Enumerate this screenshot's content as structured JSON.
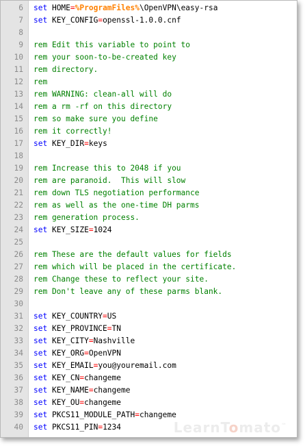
{
  "editor": {
    "colors": {
      "keyword": "#0000ff",
      "operator": "#ff0000",
      "variable": "#ff8000",
      "comment": "#008000",
      "plain": "#000000",
      "line_number": "#8a8a8a",
      "gutter": "#e4e4e4"
    },
    "lines": [
      {
        "n": "6",
        "tokens": [
          {
            "t": "set",
            "c": "kw"
          },
          {
            "t": " HOME",
            "c": "pl"
          },
          {
            "t": "=",
            "c": "op"
          },
          {
            "t": "%ProgramFiles%",
            "c": "var"
          },
          {
            "t": "\\OpenVPN\\easy-rsa",
            "c": "pl"
          }
        ]
      },
      {
        "n": "7",
        "tokens": [
          {
            "t": "set",
            "c": "kw"
          },
          {
            "t": " KEY_CONFIG",
            "c": "pl"
          },
          {
            "t": "=",
            "c": "op"
          },
          {
            "t": "openssl-1.0.0.cnf",
            "c": "pl"
          }
        ]
      },
      {
        "n": "8",
        "tokens": []
      },
      {
        "n": "9",
        "tokens": [
          {
            "t": "rem Edit this variable to point to",
            "c": "cm"
          }
        ]
      },
      {
        "n": "10",
        "tokens": [
          {
            "t": "rem your soon-to-be-created key",
            "c": "cm"
          }
        ]
      },
      {
        "n": "11",
        "tokens": [
          {
            "t": "rem directory.",
            "c": "cm"
          }
        ]
      },
      {
        "n": "12",
        "tokens": [
          {
            "t": "rem",
            "c": "cm"
          }
        ]
      },
      {
        "n": "13",
        "tokens": [
          {
            "t": "rem WARNING: clean-all will do",
            "c": "cm"
          }
        ]
      },
      {
        "n": "14",
        "tokens": [
          {
            "t": "rem a rm -rf on this directory",
            "c": "cm"
          }
        ]
      },
      {
        "n": "15",
        "tokens": [
          {
            "t": "rem so make sure you define",
            "c": "cm"
          }
        ]
      },
      {
        "n": "16",
        "tokens": [
          {
            "t": "rem it correctly!",
            "c": "cm"
          }
        ]
      },
      {
        "n": "17",
        "tokens": [
          {
            "t": "set",
            "c": "kw"
          },
          {
            "t": " KEY_DIR",
            "c": "pl"
          },
          {
            "t": "=",
            "c": "op"
          },
          {
            "t": "keys",
            "c": "pl"
          }
        ]
      },
      {
        "n": "18",
        "tokens": []
      },
      {
        "n": "19",
        "tokens": [
          {
            "t": "rem Increase this to 2048 if you",
            "c": "cm"
          }
        ]
      },
      {
        "n": "20",
        "tokens": [
          {
            "t": "rem are paranoid.  This will slow",
            "c": "cm"
          }
        ]
      },
      {
        "n": "21",
        "tokens": [
          {
            "t": "rem down TLS negotiation performance",
            "c": "cm"
          }
        ]
      },
      {
        "n": "22",
        "tokens": [
          {
            "t": "rem as well as the one-time DH parms",
            "c": "cm"
          }
        ]
      },
      {
        "n": "23",
        "tokens": [
          {
            "t": "rem generation process.",
            "c": "cm"
          }
        ]
      },
      {
        "n": "24",
        "tokens": [
          {
            "t": "set",
            "c": "kw"
          },
          {
            "t": " KEY_SIZE",
            "c": "pl"
          },
          {
            "t": "=",
            "c": "op"
          },
          {
            "t": "1024",
            "c": "pl"
          }
        ]
      },
      {
        "n": "25",
        "tokens": []
      },
      {
        "n": "26",
        "tokens": [
          {
            "t": "rem These are the default values for fields",
            "c": "cm"
          }
        ]
      },
      {
        "n": "27",
        "tokens": [
          {
            "t": "rem which will be placed in the certificate.",
            "c": "cm"
          }
        ]
      },
      {
        "n": "28",
        "tokens": [
          {
            "t": "rem Change these to reflect your site.",
            "c": "cm"
          }
        ]
      },
      {
        "n": "29",
        "tokens": [
          {
            "t": "rem Don't leave any of these parms blank.",
            "c": "cm"
          }
        ]
      },
      {
        "n": "30",
        "tokens": []
      },
      {
        "n": "31",
        "tokens": [
          {
            "t": "set",
            "c": "kw"
          },
          {
            "t": " KEY_COUNTRY",
            "c": "pl"
          },
          {
            "t": "=",
            "c": "op"
          },
          {
            "t": "US",
            "c": "pl"
          }
        ]
      },
      {
        "n": "32",
        "tokens": [
          {
            "t": "set",
            "c": "kw"
          },
          {
            "t": " KEY_PROVINCE",
            "c": "pl"
          },
          {
            "t": "=",
            "c": "op"
          },
          {
            "t": "TN",
            "c": "pl"
          }
        ]
      },
      {
        "n": "33",
        "tokens": [
          {
            "t": "set",
            "c": "kw"
          },
          {
            "t": " KEY_CITY",
            "c": "pl"
          },
          {
            "t": "=",
            "c": "op"
          },
          {
            "t": "Nashville",
            "c": "pl"
          }
        ]
      },
      {
        "n": "34",
        "tokens": [
          {
            "t": "set",
            "c": "kw"
          },
          {
            "t": " KEY_ORG",
            "c": "pl"
          },
          {
            "t": "=",
            "c": "op"
          },
          {
            "t": "OpenVPN",
            "c": "pl"
          }
        ]
      },
      {
        "n": "35",
        "tokens": [
          {
            "t": "set",
            "c": "kw"
          },
          {
            "t": " KEY_EMAIL",
            "c": "pl"
          },
          {
            "t": "=",
            "c": "op"
          },
          {
            "t": "you@youremail.com",
            "c": "pl"
          }
        ]
      },
      {
        "n": "36",
        "tokens": [
          {
            "t": "set",
            "c": "kw"
          },
          {
            "t": " KEY_CN",
            "c": "pl"
          },
          {
            "t": "=",
            "c": "op"
          },
          {
            "t": "changeme",
            "c": "pl"
          }
        ]
      },
      {
        "n": "37",
        "tokens": [
          {
            "t": "set",
            "c": "kw"
          },
          {
            "t": " KEY_NAME",
            "c": "pl"
          },
          {
            "t": "=",
            "c": "op"
          },
          {
            "t": "changeme",
            "c": "pl"
          }
        ]
      },
      {
        "n": "38",
        "tokens": [
          {
            "t": "set",
            "c": "kw"
          },
          {
            "t": " KEY_OU",
            "c": "pl"
          },
          {
            "t": "=",
            "c": "op"
          },
          {
            "t": "changeme",
            "c": "pl"
          }
        ]
      },
      {
        "n": "39",
        "tokens": [
          {
            "t": "set",
            "c": "kw"
          },
          {
            "t": " PKCS11_MODULE_PATH",
            "c": "pl"
          },
          {
            "t": "=",
            "c": "op"
          },
          {
            "t": "changeme",
            "c": "pl"
          }
        ]
      },
      {
        "n": "40",
        "tokens": [
          {
            "t": "set",
            "c": "kw"
          },
          {
            "t": " PKCS11_PIN",
            "c": "pl"
          },
          {
            "t": "=",
            "c": "op"
          },
          {
            "t": "1234",
            "c": "pl"
          }
        ]
      }
    ]
  },
  "watermark": {
    "part1": "LearnT",
    "part2": "o",
    "part3": "mato",
    "tm": "™"
  }
}
